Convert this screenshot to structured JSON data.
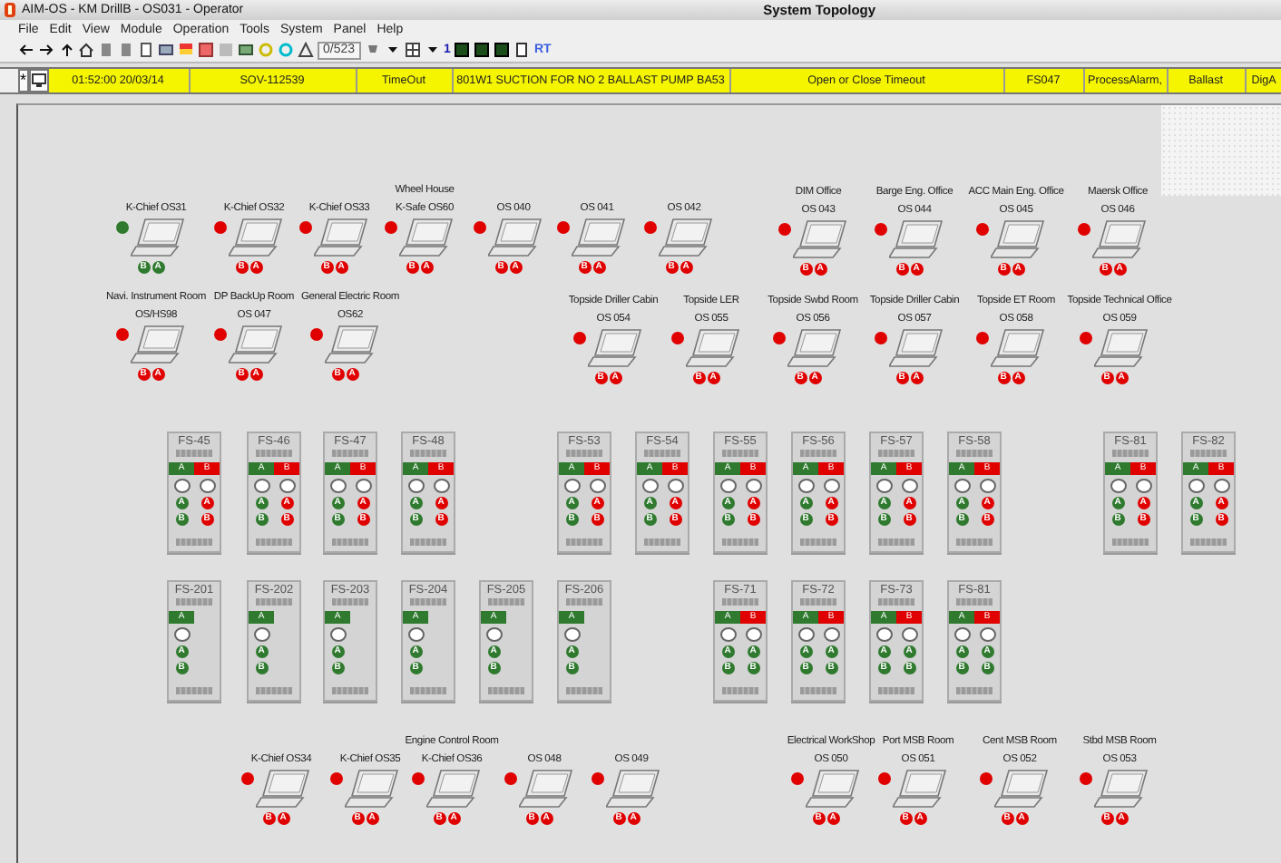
{
  "window": {
    "title": "AIM-OS - KM DrillB - OS031 - Operator",
    "view_title": "System Topology"
  },
  "menu": [
    "File",
    "Edit",
    "View",
    "Module",
    "Operation",
    "Tools",
    "System",
    "Panel",
    "Help"
  ],
  "toolbar": {
    "counter": "0/523",
    "page_button": "1",
    "realtime_button": "RT"
  },
  "alarm": {
    "pin_button": "*",
    "cells": [
      "01:52:00 20/03/14",
      "SOV-112539",
      "TimeOut",
      "801W1 SUCTION FOR NO 2 BALLAST PUMP BA53",
      "Open or Close Timeout",
      "FS047",
      "ProcessAlarm,",
      "Ballast",
      "DigA"
    ]
  },
  "workstations": [
    {
      "name": "K-Chief  OS31",
      "alarm": false,
      "ports": [
        {
          "label": "B",
          "alarm": false
        },
        {
          "label": "A",
          "alarm": false
        }
      ]
    },
    {
      "name": "K-Chief  OS32",
      "alarm": true,
      "ports": [
        {
          "label": "B",
          "alarm": true
        },
        {
          "label": "A",
          "alarm": true
        }
      ]
    },
    {
      "name": "K-Chief  OS33",
      "alarm": true,
      "ports": [
        {
          "label": "B",
          "alarm": true
        },
        {
          "label": "A",
          "alarm": true
        }
      ]
    },
    {
      "room": "Wheel House",
      "name": "K-Safe  OS60",
      "alarm": true,
      "ports": [
        {
          "label": "B",
          "alarm": true
        },
        {
          "label": "A",
          "alarm": true
        }
      ]
    },
    {
      "name": "OS 040",
      "alarm": true,
      "ports": [
        {
          "label": "B",
          "alarm": true
        },
        {
          "label": "A",
          "alarm": true
        }
      ]
    },
    {
      "name": "OS 041",
      "alarm": true,
      "ports": [
        {
          "label": "B",
          "alarm": true
        },
        {
          "label": "A",
          "alarm": true
        }
      ]
    },
    {
      "name": "OS 042",
      "alarm": true,
      "ports": [
        {
          "label": "B",
          "alarm": true
        },
        {
          "label": "A",
          "alarm": true
        }
      ]
    },
    {
      "room": "DIM Office",
      "name": "OS 043",
      "alarm": true,
      "ports": [
        {
          "label": "B",
          "alarm": true
        },
        {
          "label": "A",
          "alarm": true
        }
      ]
    },
    {
      "room": "Barge Eng. Office",
      "name": "OS 044",
      "alarm": true,
      "ports": [
        {
          "label": "B",
          "alarm": true
        },
        {
          "label": "A",
          "alarm": true
        }
      ]
    },
    {
      "room": "ACC Main Eng. Office",
      "name": "OS 045",
      "alarm": true,
      "ports": [
        {
          "label": "B",
          "alarm": true
        },
        {
          "label": "A",
          "alarm": true
        }
      ]
    },
    {
      "room": "Maersk Office",
      "name": "OS 046",
      "alarm": true,
      "ports": [
        {
          "label": "B",
          "alarm": true
        },
        {
          "label": "A",
          "alarm": true
        }
      ]
    },
    {
      "room": "Navi. Instrument Room",
      "name": "OS/HS98",
      "alarm": true,
      "ports": [
        {
          "label": "B",
          "alarm": true
        },
        {
          "label": "A",
          "alarm": true
        }
      ]
    },
    {
      "room": "DP BackUp Room",
      "name": "OS 047",
      "alarm": true,
      "ports": [
        {
          "label": "B",
          "alarm": true
        },
        {
          "label": "A",
          "alarm": true
        }
      ]
    },
    {
      "room": "General Electric Room",
      "name": "OS62",
      "alarm": true,
      "ports": [
        {
          "label": "B",
          "alarm": true
        },
        {
          "label": "A",
          "alarm": true
        }
      ]
    },
    {
      "room": "Topside Driller Cabin",
      "name": "OS 054",
      "alarm": true,
      "ports": [
        {
          "label": "B",
          "alarm": true
        },
        {
          "label": "A",
          "alarm": true
        }
      ]
    },
    {
      "room": "Topside LER",
      "name": "OS 055",
      "alarm": true,
      "ports": [
        {
          "label": "B",
          "alarm": true
        },
        {
          "label": "A",
          "alarm": true
        }
      ]
    },
    {
      "room": "Topside Swbd Room",
      "name": "OS 056",
      "alarm": true,
      "ports": [
        {
          "label": "B",
          "alarm": true
        },
        {
          "label": "A",
          "alarm": true
        }
      ]
    },
    {
      "room": "Topside Driller Cabin",
      "name": "OS 057",
      "alarm": true,
      "ports": [
        {
          "label": "B",
          "alarm": true
        },
        {
          "label": "A",
          "alarm": true
        }
      ]
    },
    {
      "room": "Topside ET Room",
      "name": "OS 058",
      "alarm": true,
      "ports": [
        {
          "label": "B",
          "alarm": true
        },
        {
          "label": "A",
          "alarm": true
        }
      ]
    },
    {
      "room": "Topside Technical Office",
      "name": "OS 059",
      "alarm": true,
      "ports": [
        {
          "label": "B",
          "alarm": true
        },
        {
          "label": "A",
          "alarm": true
        }
      ]
    },
    {
      "name": "K-Chief OS34",
      "alarm": true,
      "ports": [
        {
          "label": "B",
          "alarm": true
        },
        {
          "label": "A",
          "alarm": true
        }
      ]
    },
    {
      "name": "K-Chief OS35",
      "alarm": true,
      "ports": [
        {
          "label": "B",
          "alarm": true
        },
        {
          "label": "A",
          "alarm": true
        }
      ]
    },
    {
      "room": "Engine Control Room",
      "name": "K-Chief OS36",
      "alarm": true,
      "ports": [
        {
          "label": "B",
          "alarm": true
        },
        {
          "label": "A",
          "alarm": true
        }
      ]
    },
    {
      "name": "OS 048",
      "alarm": true,
      "ports": [
        {
          "label": "B",
          "alarm": true
        },
        {
          "label": "A",
          "alarm": true
        }
      ]
    },
    {
      "name": "OS 049",
      "alarm": true,
      "ports": [
        {
          "label": "B",
          "alarm": true
        },
        {
          "label": "A",
          "alarm": true
        }
      ]
    },
    {
      "room": "Electrical WorkShop",
      "name": "OS 050",
      "alarm": true,
      "ports": [
        {
          "label": "B",
          "alarm": true
        },
        {
          "label": "A",
          "alarm": true
        }
      ]
    },
    {
      "room": "Port MSB Room",
      "name": "OS 051",
      "alarm": true,
      "ports": [
        {
          "label": "B",
          "alarm": true
        },
        {
          "label": "A",
          "alarm": true
        }
      ]
    },
    {
      "room": "Cent MSB Room",
      "name": "OS 052",
      "alarm": true,
      "ports": [
        {
          "label": "B",
          "alarm": true
        },
        {
          "label": "A",
          "alarm": true
        }
      ]
    },
    {
      "room": "Stbd MSB Room",
      "name": "OS 053",
      "alarm": true,
      "ports": [
        {
          "label": "B",
          "alarm": true
        },
        {
          "label": "A",
          "alarm": true
        }
      ]
    }
  ],
  "racks": [
    {
      "name": "FS-45",
      "sides": [
        {
          "label": "A",
          "alarm": false,
          "ports": [
            {
              "label": "A",
              "alarm": false
            },
            {
              "label": "B",
              "alarm": false
            }
          ]
        },
        {
          "label": "B",
          "alarm": true,
          "ports": [
            {
              "label": "A",
              "alarm": true
            },
            {
              "label": "B",
              "alarm": true
            }
          ]
        }
      ]
    },
    {
      "name": "FS-46",
      "sides": [
        {
          "label": "A",
          "alarm": false,
          "ports": [
            {
              "label": "A",
              "alarm": false
            },
            {
              "label": "B",
              "alarm": false
            }
          ]
        },
        {
          "label": "B",
          "alarm": true,
          "ports": [
            {
              "label": "A",
              "alarm": true
            },
            {
              "label": "B",
              "alarm": true
            }
          ]
        }
      ]
    },
    {
      "name": "FS-47",
      "sides": [
        {
          "label": "A",
          "alarm": false,
          "ports": [
            {
              "label": "A",
              "alarm": false
            },
            {
              "label": "B",
              "alarm": false
            }
          ]
        },
        {
          "label": "B",
          "alarm": true,
          "ports": [
            {
              "label": "A",
              "alarm": true
            },
            {
              "label": "B",
              "alarm": true
            }
          ]
        }
      ]
    },
    {
      "name": "FS-48",
      "sides": [
        {
          "label": "A",
          "alarm": false,
          "ports": [
            {
              "label": "A",
              "alarm": false
            },
            {
              "label": "B",
              "alarm": false
            }
          ]
        },
        {
          "label": "B",
          "alarm": true,
          "ports": [
            {
              "label": "A",
              "alarm": true
            },
            {
              "label": "B",
              "alarm": true
            }
          ]
        }
      ]
    },
    {
      "name": "FS-53",
      "sides": [
        {
          "label": "A",
          "alarm": false,
          "ports": [
            {
              "label": "A",
              "alarm": false
            },
            {
              "label": "B",
              "alarm": false
            }
          ]
        },
        {
          "label": "B",
          "alarm": true,
          "ports": [
            {
              "label": "A",
              "alarm": true
            },
            {
              "label": "B",
              "alarm": true
            }
          ]
        }
      ]
    },
    {
      "name": "FS-54",
      "sides": [
        {
          "label": "A",
          "alarm": false,
          "ports": [
            {
              "label": "A",
              "alarm": false
            },
            {
              "label": "B",
              "alarm": false
            }
          ]
        },
        {
          "label": "B",
          "alarm": true,
          "ports": [
            {
              "label": "A",
              "alarm": true
            },
            {
              "label": "B",
              "alarm": true
            }
          ]
        }
      ]
    },
    {
      "name": "FS-55",
      "sides": [
        {
          "label": "A",
          "alarm": false,
          "ports": [
            {
              "label": "A",
              "alarm": false
            },
            {
              "label": "B",
              "alarm": false
            }
          ]
        },
        {
          "label": "B",
          "alarm": true,
          "ports": [
            {
              "label": "A",
              "alarm": true
            },
            {
              "label": "B",
              "alarm": true
            }
          ]
        }
      ]
    },
    {
      "name": "FS-56",
      "sides": [
        {
          "label": "A",
          "alarm": false,
          "ports": [
            {
              "label": "A",
              "alarm": false
            },
            {
              "label": "B",
              "alarm": false
            }
          ]
        },
        {
          "label": "B",
          "alarm": true,
          "ports": [
            {
              "label": "A",
              "alarm": true
            },
            {
              "label": "B",
              "alarm": true
            }
          ]
        }
      ]
    },
    {
      "name": "FS-57",
      "sides": [
        {
          "label": "A",
          "alarm": false,
          "ports": [
            {
              "label": "A",
              "alarm": false
            },
            {
              "label": "B",
              "alarm": false
            }
          ]
        },
        {
          "label": "B",
          "alarm": true,
          "ports": [
            {
              "label": "A",
              "alarm": true
            },
            {
              "label": "B",
              "alarm": true
            }
          ]
        }
      ]
    },
    {
      "name": "FS-58",
      "sides": [
        {
          "label": "A",
          "alarm": false,
          "ports": [
            {
              "label": "A",
              "alarm": false
            },
            {
              "label": "B",
              "alarm": false
            }
          ]
        },
        {
          "label": "B",
          "alarm": true,
          "ports": [
            {
              "label": "A",
              "alarm": true
            },
            {
              "label": "B",
              "alarm": true
            }
          ]
        }
      ]
    },
    {
      "name": "FS-81",
      "sides": [
        {
          "label": "A",
          "alarm": false,
          "ports": [
            {
              "label": "A",
              "alarm": false
            },
            {
              "label": "B",
              "alarm": false
            }
          ]
        },
        {
          "label": "B",
          "alarm": true,
          "ports": [
            {
              "label": "A",
              "alarm": true
            },
            {
              "label": "B",
              "alarm": true
            }
          ]
        }
      ]
    },
    {
      "name": "FS-82",
      "sides": [
        {
          "label": "A",
          "alarm": false,
          "ports": [
            {
              "label": "A",
              "alarm": false
            },
            {
              "label": "B",
              "alarm": false
            }
          ]
        },
        {
          "label": "B",
          "alarm": true,
          "ports": [
            {
              "label": "A",
              "alarm": true
            },
            {
              "label": "B",
              "alarm": true
            }
          ]
        }
      ]
    },
    {
      "name": "FS-201",
      "sides": [
        {
          "label": "A",
          "alarm": false,
          "ports": [
            {
              "label": "A",
              "alarm": false
            },
            {
              "label": "B",
              "alarm": false
            }
          ]
        }
      ]
    },
    {
      "name": "FS-202",
      "sides": [
        {
          "label": "A",
          "alarm": false,
          "ports": [
            {
              "label": "A",
              "alarm": false
            },
            {
              "label": "B",
              "alarm": false
            }
          ]
        }
      ]
    },
    {
      "name": "FS-203",
      "sides": [
        {
          "label": "A",
          "alarm": false,
          "ports": [
            {
              "label": "A",
              "alarm": false
            },
            {
              "label": "B",
              "alarm": false
            }
          ]
        }
      ]
    },
    {
      "name": "FS-204",
      "sides": [
        {
          "label": "A",
          "alarm": false,
          "ports": [
            {
              "label": "A",
              "alarm": false
            },
            {
              "label": "B",
              "alarm": false
            }
          ]
        }
      ]
    },
    {
      "name": "FS-205",
      "sides": [
        {
          "label": "A",
          "alarm": false,
          "ports": [
            {
              "label": "A",
              "alarm": false
            },
            {
              "label": "B",
              "alarm": false
            }
          ]
        }
      ]
    },
    {
      "name": "FS-206",
      "sides": [
        {
          "label": "A",
          "alarm": false,
          "ports": [
            {
              "label": "A",
              "alarm": false
            },
            {
              "label": "B",
              "alarm": false
            }
          ]
        }
      ]
    },
    {
      "name": "FS-71",
      "sides": [
        {
          "label": "A",
          "alarm": false,
          "ports": [
            {
              "label": "A",
              "alarm": false
            },
            {
              "label": "B",
              "alarm": false
            }
          ]
        },
        {
          "label": "B",
          "alarm": true,
          "ports": [
            {
              "label": "A",
              "alarm": false
            },
            {
              "label": "B",
              "alarm": false
            }
          ]
        }
      ]
    },
    {
      "name": "FS-72",
      "sides": [
        {
          "label": "A",
          "alarm": false,
          "ports": [
            {
              "label": "A",
              "alarm": false
            },
            {
              "label": "B",
              "alarm": false
            }
          ]
        },
        {
          "label": "B",
          "alarm": true,
          "ports": [
            {
              "label": "A",
              "alarm": false
            },
            {
              "label": "B",
              "alarm": false
            }
          ]
        }
      ]
    },
    {
      "name": "FS-73",
      "sides": [
        {
          "label": "A",
          "alarm": false,
          "ports": [
            {
              "label": "A",
              "alarm": false
            },
            {
              "label": "B",
              "alarm": false
            }
          ]
        },
        {
          "label": "B",
          "alarm": true,
          "ports": [
            {
              "label": "A",
              "alarm": false
            },
            {
              "label": "B",
              "alarm": false
            }
          ]
        }
      ]
    },
    {
      "name": "FS-81",
      "sides": [
        {
          "label": "A",
          "alarm": false,
          "ports": [
            {
              "label": "A",
              "alarm": false
            },
            {
              "label": "B",
              "alarm": false
            }
          ]
        },
        {
          "label": "B",
          "alarm": true,
          "ports": [
            {
              "label": "A",
              "alarm": false
            },
            {
              "label": "B",
              "alarm": false
            }
          ]
        }
      ]
    }
  ]
}
